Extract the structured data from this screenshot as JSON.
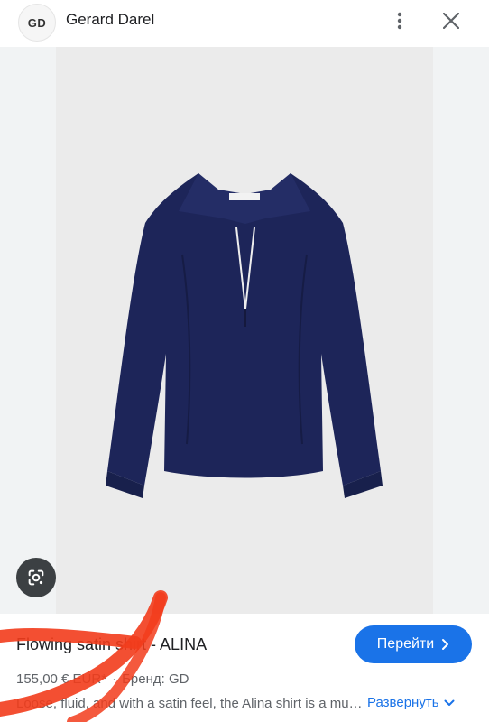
{
  "header": {
    "logo_text": "GD",
    "site_name": "Gerard Darel",
    "menu_icon": "more-vert-icon",
    "close_icon": "close-icon"
  },
  "product": {
    "title": "Flowing satin shirt - ALINA",
    "price": "155,00 € EUR*",
    "separator": "·",
    "brand": "Бренд: GD",
    "description": "Loose, fluid, and with a satin feel, the Alina shirt is a must-have for stylish outfits.",
    "go_label": "Перейти",
    "expand_label": "Развернуть",
    "image_label": "navy satin shirt"
  },
  "colors": {
    "accent": "#1a73e8",
    "shirt": "#1d2559",
    "scribble": "#f23c1c"
  }
}
